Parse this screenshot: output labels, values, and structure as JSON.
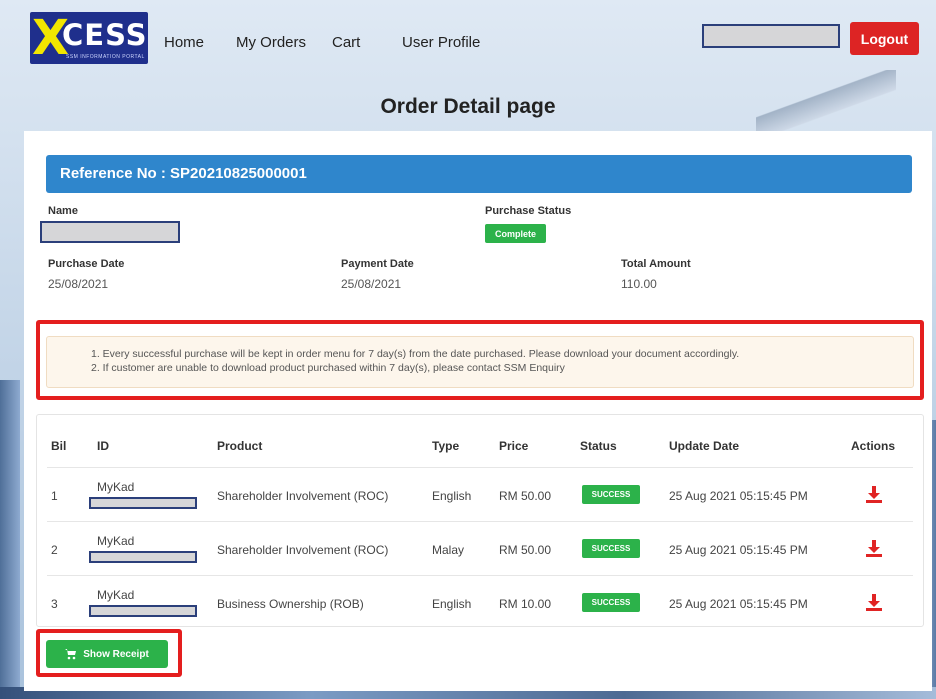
{
  "brand": {
    "logo_text": "CESS",
    "logo_mark": "X",
    "logo_sub": "SSM INFORMATION PORTAL"
  },
  "nav": [
    {
      "label": "Home"
    },
    {
      "label": "My Orders"
    },
    {
      "label": "Cart"
    },
    {
      "label": "User Profile"
    }
  ],
  "header": {
    "logout_label": "Logout"
  },
  "page_title": "Order Detail page",
  "order": {
    "reference": "Reference No : SP20210825000001",
    "name_label": "Name",
    "purchase_status_label": "Purchase Status",
    "purchase_status": "Complete",
    "purchase_date_label": "Purchase Date",
    "purchase_date": "25/08/2021",
    "payment_date_label": "Payment Date",
    "payment_date": "25/08/2021",
    "total_amount_label": "Total Amount",
    "total_amount": "110.00"
  },
  "notice": {
    "line1": "1. Every successful purchase will be kept in order menu for 7 day(s) from the date purchased. Please download your document accordingly.",
    "line2": "2. If customer are unable to download product purchased within 7 day(s), please contact SSM Enquiry"
  },
  "table": {
    "headers": [
      "Bil",
      "ID",
      "Product",
      "Type",
      "Price",
      "Status",
      "Update Date",
      "Actions"
    ],
    "rows": [
      {
        "bil": "1",
        "id_type": "MyKad",
        "product": "Shareholder Involvement (ROC)",
        "type": "English",
        "price": "RM 50.00",
        "status": "SUCCESS",
        "update_date": "25 Aug 2021 05:15:45 PM"
      },
      {
        "bil": "2",
        "id_type": "MyKad",
        "product": "Shareholder Involvement (ROC)",
        "type": "Malay",
        "price": "RM 50.00",
        "status": "SUCCESS",
        "update_date": "25 Aug 2021 05:15:45 PM"
      },
      {
        "bil": "3",
        "id_type": "MyKad",
        "product": "Business Ownership (ROB)",
        "type": "English",
        "price": "RM 10.00",
        "status": "SUCCESS",
        "update_date": "25 Aug 2021 05:15:45 PM"
      }
    ]
  },
  "receipt_label": "Show Receipt",
  "colors": {
    "accent_blue": "#2f86cc",
    "success_green": "#2cb24a",
    "danger_red": "#dd2424"
  },
  "icons": {
    "download": "download-icon",
    "cart": "cart-icon"
  }
}
